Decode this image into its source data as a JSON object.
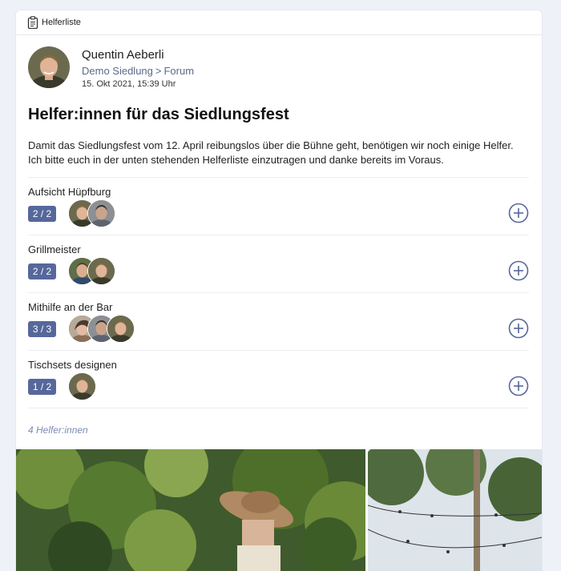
{
  "header": {
    "label": "Helferliste",
    "icon": "clipboard-icon"
  },
  "post": {
    "author_name": "Quentin Aeberli",
    "location": {
      "community": "Demo Siedlung",
      "separator": ">",
      "section": "Forum"
    },
    "date": "15. Okt 2021, 15:39 Uhr",
    "title": "Helfer:innen für das Siedlungsfest",
    "description": "Damit das Siedlungsfest vom 12. April reibungslos über die Bühne geht, benötigen wir noch einige Helfer. Ich bitte euch in der unten stehenden Helferliste einzutragen und danke bereits im Voraus."
  },
  "tasks": [
    {
      "name": "Aufsicht Hüpfburg",
      "count": "2 / 2",
      "filled": 2,
      "capacity": 2
    },
    {
      "name": "Grillmeister",
      "count": "2 / 2",
      "filled": 2,
      "capacity": 2
    },
    {
      "name": "Mithilfe an der Bar",
      "count": "3 / 3",
      "filled": 3,
      "capacity": 3
    },
    {
      "name": "Tischsets designen",
      "count": "1 / 2",
      "filled": 1,
      "capacity": 2
    }
  ],
  "helper_count": "4 Helfer:innen",
  "colors": {
    "accent": "#56679b",
    "link": "#5a6a86",
    "muted": "#7b8cb3",
    "page_bg": "#eef1f8"
  }
}
